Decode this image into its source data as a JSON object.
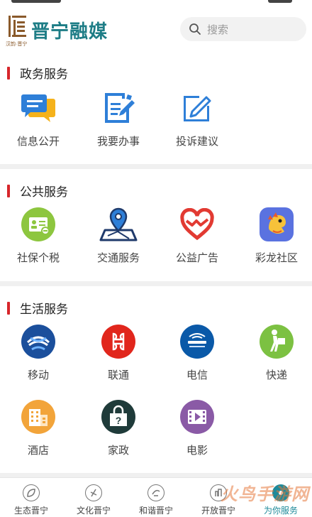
{
  "header": {
    "logo_title": "晋宁融媒",
    "logo_sub": "汉韵·晋宁",
    "search_placeholder": "搜索"
  },
  "sections": {
    "gov": {
      "title": "政务服务",
      "items": [
        {
          "label": "信息公开",
          "icon": "chat-bubbles-icon"
        },
        {
          "label": "我要办事",
          "icon": "document-pen-icon"
        },
        {
          "label": "投诉建议",
          "icon": "edit-square-icon"
        }
      ]
    },
    "public": {
      "title": "公共服务",
      "items": [
        {
          "label": "社保个税",
          "icon": "id-card-icon"
        },
        {
          "label": "交通服务",
          "icon": "map-pin-icon"
        },
        {
          "label": "公益广告",
          "icon": "heart-icon"
        },
        {
          "label": "彩龙社区",
          "icon": "dragon-icon"
        }
      ]
    },
    "life": {
      "title": "生活服务",
      "items": [
        {
          "label": "移动",
          "icon": "china-mobile-icon"
        },
        {
          "label": "联通",
          "icon": "china-unicom-icon"
        },
        {
          "label": "电信",
          "icon": "china-telecom-icon"
        },
        {
          "label": "快递",
          "icon": "courier-icon"
        },
        {
          "label": "酒店",
          "icon": "hotel-icon"
        },
        {
          "label": "家政",
          "icon": "housekeeping-icon"
        },
        {
          "label": "电影",
          "icon": "movie-icon"
        }
      ]
    }
  },
  "tabbar": {
    "tabs": [
      {
        "label": "生态晋宁"
      },
      {
        "label": "文化晋宁"
      },
      {
        "label": "和谐晋宁"
      },
      {
        "label": "开放晋宁"
      },
      {
        "label": "为你服务",
        "active": true
      }
    ]
  },
  "watermark": "火鸟手游网",
  "colors": {
    "brand": "#1e7d86",
    "section_bar": "#d7262b",
    "active_tab": "#1e8a9a"
  }
}
